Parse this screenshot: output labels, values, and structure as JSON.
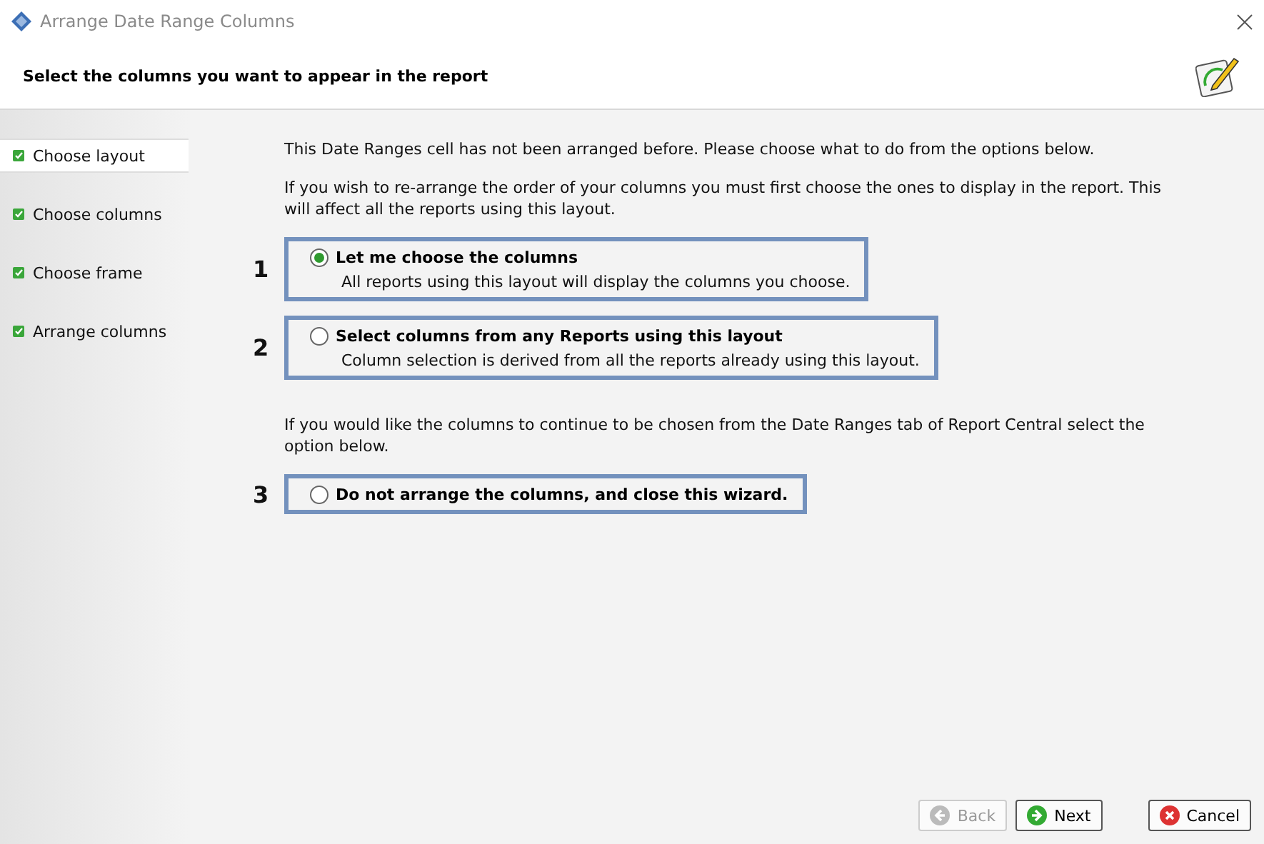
{
  "window": {
    "title": "Arrange Date Range Columns"
  },
  "header": {
    "title": "Select the columns you want to appear in the report"
  },
  "sidebar": {
    "items": [
      {
        "label": "Choose layout",
        "selected": true,
        "done": true
      },
      {
        "label": "Choose columns",
        "selected": false,
        "done": true
      },
      {
        "label": "Choose frame",
        "selected": false,
        "done": true
      },
      {
        "label": "Arrange columns",
        "selected": false,
        "done": true
      }
    ]
  },
  "content": {
    "blocks": [
      {
        "kind": "text",
        "text": "This Date Ranges cell has not been arranged before. Please choose what to do from the options below."
      },
      {
        "kind": "text",
        "text": "If you wish to re-arrange the order of your columns you must first choose the ones to display in the report. This will affect all the reports using this layout."
      },
      {
        "kind": "option",
        "number": "1",
        "label": "Let me choose the columns",
        "description": "All reports using this layout will display the columns you choose.",
        "selected": true
      },
      {
        "kind": "option",
        "number": "2",
        "label": "Select columns from any Reports using this layout",
        "description": "Column selection is derived from all the reports already using this layout.",
        "selected": false
      },
      {
        "kind": "text",
        "text": "If you would like the columns to continue to be chosen from the Date Ranges tab of Report Central select the option below."
      },
      {
        "kind": "option",
        "number": "3",
        "label": "Do not arrange the columns, and close this wizard.",
        "selected": false
      }
    ]
  },
  "buttons": [
    {
      "kind": "back",
      "label": "Back",
      "disabled": true
    },
    {
      "kind": "next",
      "label": "Next",
      "disabled": false
    },
    {
      "kind": "cancel",
      "label": "Cancel",
      "disabled": false
    }
  ]
}
